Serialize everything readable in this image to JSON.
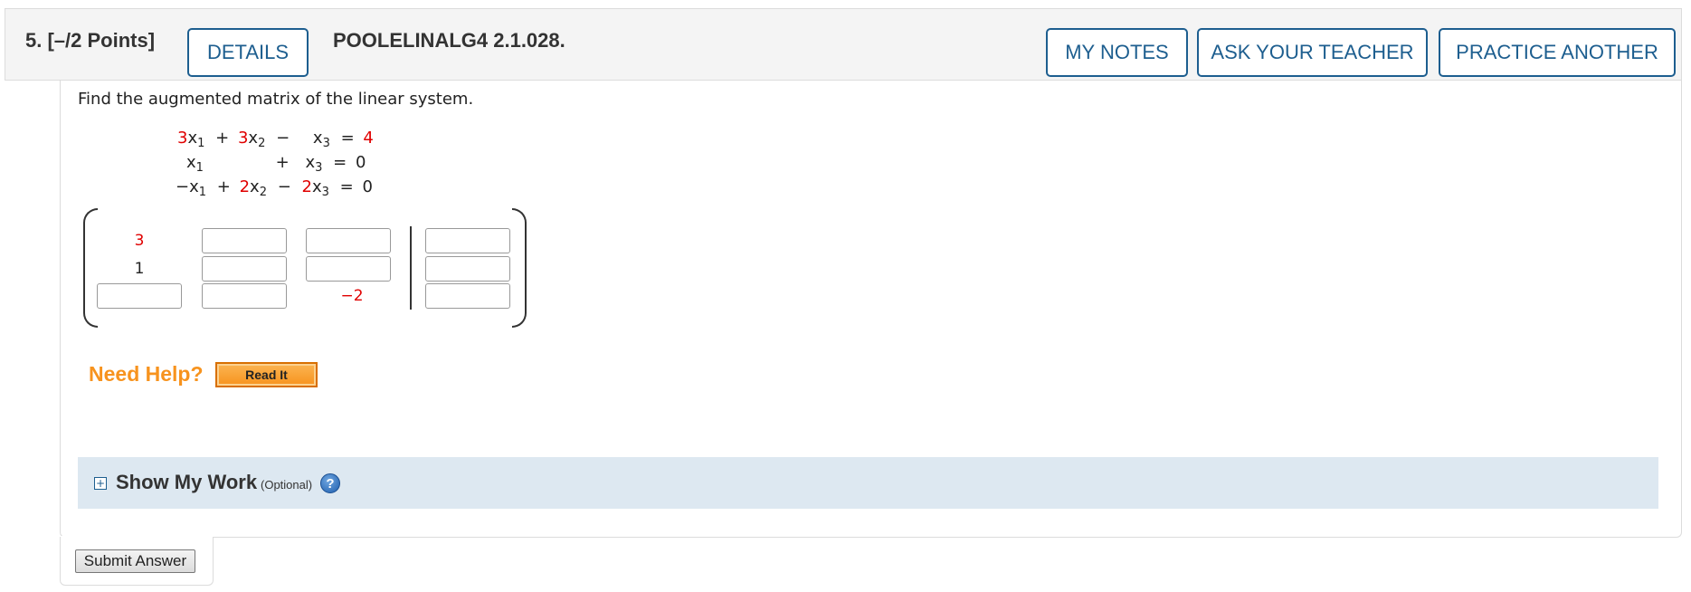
{
  "header": {
    "question_number": "5.",
    "points": "[–/2 Points]",
    "details_label": "DETAILS",
    "question_code": "POOLELINALG4 2.1.028.",
    "my_notes_label": "MY NOTES",
    "ask_teacher_label": "ASK YOUR TEACHER",
    "practice_another_label": "PRACTICE ANOTHER"
  },
  "prompt": "Find the augmented matrix of the linear system.",
  "equations": {
    "r1": {
      "c1": "3",
      "v1": "x",
      "s1": "1",
      "op1": "+",
      "c2": "3",
      "v2": "x",
      "s2": "2",
      "op2": "−",
      "v3": "x",
      "s3": "3",
      "eq": "=",
      "rhs": "4"
    },
    "r2": {
      "v1": "x",
      "s1": "1",
      "op2": "+",
      "v3": "x",
      "s3": "3",
      "eq": "=",
      "rhs": "0"
    },
    "r3": {
      "lead": "−",
      "v1": "x",
      "s1": "1",
      "op1": "+",
      "c2": "2",
      "v2": "x",
      "s2": "2",
      "op2": "−",
      "c3": "2",
      "v3": "x",
      "s3": "3",
      "eq": "=",
      "rhs": "0"
    }
  },
  "matrix": {
    "given": {
      "r1c1": "3",
      "r2c1": "1",
      "r3c3": "−2"
    },
    "inputs": {
      "r1c2": "",
      "r1c3": "",
      "r1c4": "",
      "r2c2": "",
      "r2c3": "",
      "r2c4": "",
      "r3c1": "",
      "r3c2": "",
      "r3c4": ""
    },
    "colors": {
      "given_red": "#e00000",
      "given_black": "#222222"
    }
  },
  "help": {
    "need_help_label": "Need Help?",
    "read_it_label": "Read It"
  },
  "show_my_work": {
    "toggle_symbol": "+",
    "title": "Show My Work",
    "optional": "(Optional)",
    "help_symbol": "?"
  },
  "submit_label": "Submit Answer",
  "colors": {
    "accent": "#1d5e8f",
    "help_orange": "#f7931e",
    "show_work_bg": "#dde8f1"
  }
}
